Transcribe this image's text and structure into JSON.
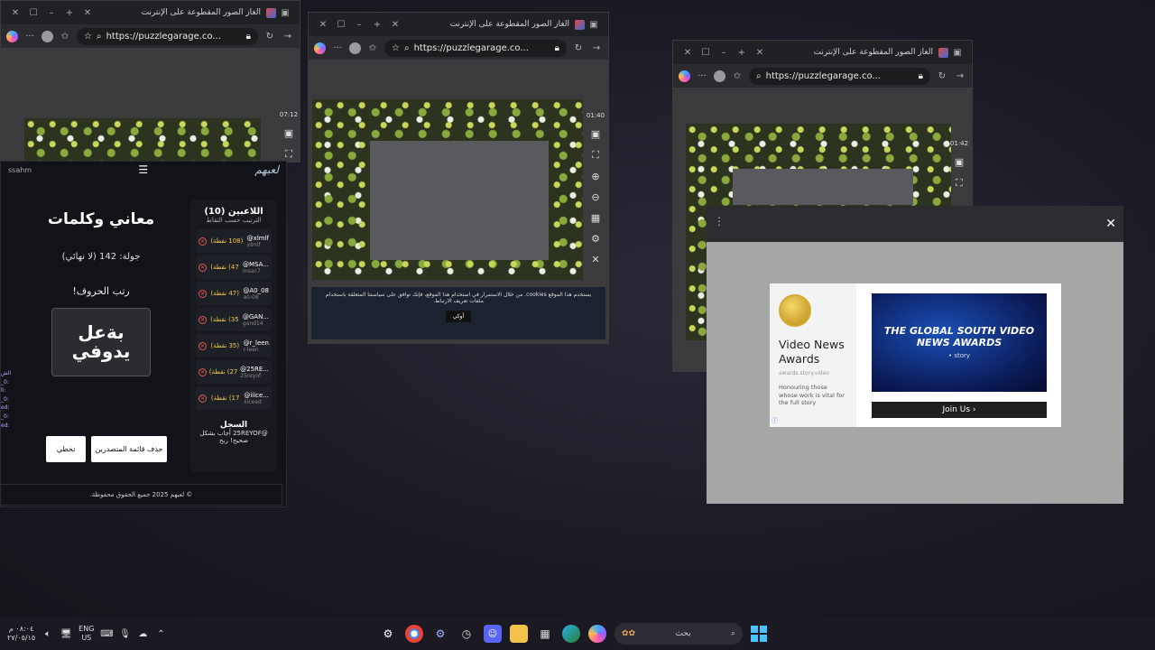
{
  "browser": {
    "tab_title": "ألغاز الصور المقطوعة على الإنترنت",
    "url": "https://puzzlegarage.co...",
    "timer_left": "07:12",
    "timer_mid": "01:40",
    "timer_right": "01:42"
  },
  "game": {
    "username": "ssahm",
    "logo": "لعبهم",
    "title": "معاني وكلمات",
    "round": "جولة: 142 (لا نهائي)",
    "instruction": "رتب الحروف!",
    "scrambled": "بةعل\nيدوفي",
    "skip_button": "تخطي",
    "clear_leaderboard_button": "حذف قائمة المتصدرين",
    "players_title": "اللاعبين (10)",
    "players_subtitle": "الترتيب حسب النقاط",
    "players": [
      {
        "name": "@xlmlf",
        "handle": "xlmlf",
        "points": "(108 نقطة)"
      },
      {
        "name": "@MSA...",
        "handle": "msac7",
        "points": "47) نقطة)"
      },
      {
        "name": "@A0_08",
        "handle": "a0-08",
        "points": "(47 نقطة)"
      },
      {
        "name": "@GAN...",
        "handle": "gand14",
        "points": "35) نقطة)"
      },
      {
        "name": "@r_leen",
        "handle": "r-leen",
        "points": "(35 نقطة)"
      },
      {
        "name": "@25RE...",
        "handle": "25reyof",
        "points": "27) نقطة)"
      },
      {
        "name": "@iiice...",
        "handle": "iiiceed",
        "points": "17) نقطة)"
      }
    ],
    "log_title": "السجل",
    "log_text": "@25REYOF أجاب بشكل صحيح! ربح",
    "footer": "© لعبهم 2025 جميع الحقوق محفوظة."
  },
  "cookie": {
    "text": "يستخدم هذا الموقع cookies. من خلال الاستمرار في استخدام هذا الموقع، فإنك توافق على سياستنا المتعلقة باستخدام ملفات تعريف الارتباط.",
    "ok": "أوكي"
  },
  "ad": {
    "brand": "Video News Awards",
    "url": "awards.story.video",
    "description": "Honouring those whose work is vital for the full story",
    "image_text": "THE GLOBAL SOUTH VIDEO NEWS AWARDS",
    "image_brand": "• story",
    "cta": "Join Us"
  },
  "taskbar": {
    "time": "٠٨:٠٤ م",
    "date": "٢٧/٠٥/١٥",
    "lang_top": "ENG",
    "lang_bottom": "US",
    "search_placeholder": "بحث"
  },
  "colors": {
    "accent": "#4cc2ff",
    "ad_cta": "#1f1f1f",
    "gold": "#f2c94c"
  }
}
